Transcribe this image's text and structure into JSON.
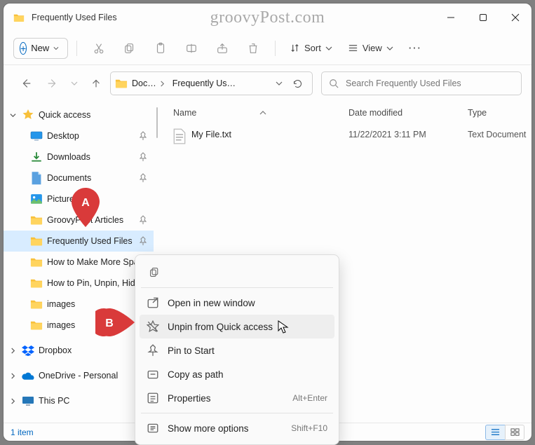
{
  "watermark": "groovyPost.com",
  "window": {
    "title": "Frequently Used Files"
  },
  "toolbar": {
    "new_label": "New",
    "sort_label": "Sort",
    "view_label": "View"
  },
  "breadcrumbs": {
    "seg0": "Doc…",
    "seg1": "Frequently Us…"
  },
  "search": {
    "placeholder": "Search Frequently Used Files"
  },
  "columns": {
    "name": "Name",
    "date": "Date modified",
    "type": "Type"
  },
  "files": {
    "row0": {
      "name": "My File.txt",
      "date": "11/22/2021 3:11 PM",
      "type": "Text Document"
    }
  },
  "sidebar": {
    "quick_access": "Quick access",
    "items": {
      "desktop": "Desktop",
      "downloads": "Downloads",
      "documents": "Documents",
      "pictures": "Pictures",
      "gp_articles": "GroovyPost Articles",
      "freq_used": "Frequently Used Files",
      "how_space": "How to Make More Spa",
      "how_pin": "How to Pin, Unpin, Hid",
      "images1": "images",
      "images2": "images"
    },
    "dropbox": "Dropbox",
    "onedrive": "OneDrive - Personal",
    "thispc": "This PC"
  },
  "context_menu": {
    "open_new_window": "Open in new window",
    "unpin": "Unpin from Quick access",
    "pin_start": "Pin to Start",
    "copy_path": "Copy as path",
    "properties": "Properties",
    "properties_shortcut": "Alt+Enter",
    "show_more": "Show more options",
    "show_more_shortcut": "Shift+F10"
  },
  "status": {
    "count": "1 item"
  },
  "markers": {
    "a": "A",
    "b": "B"
  }
}
